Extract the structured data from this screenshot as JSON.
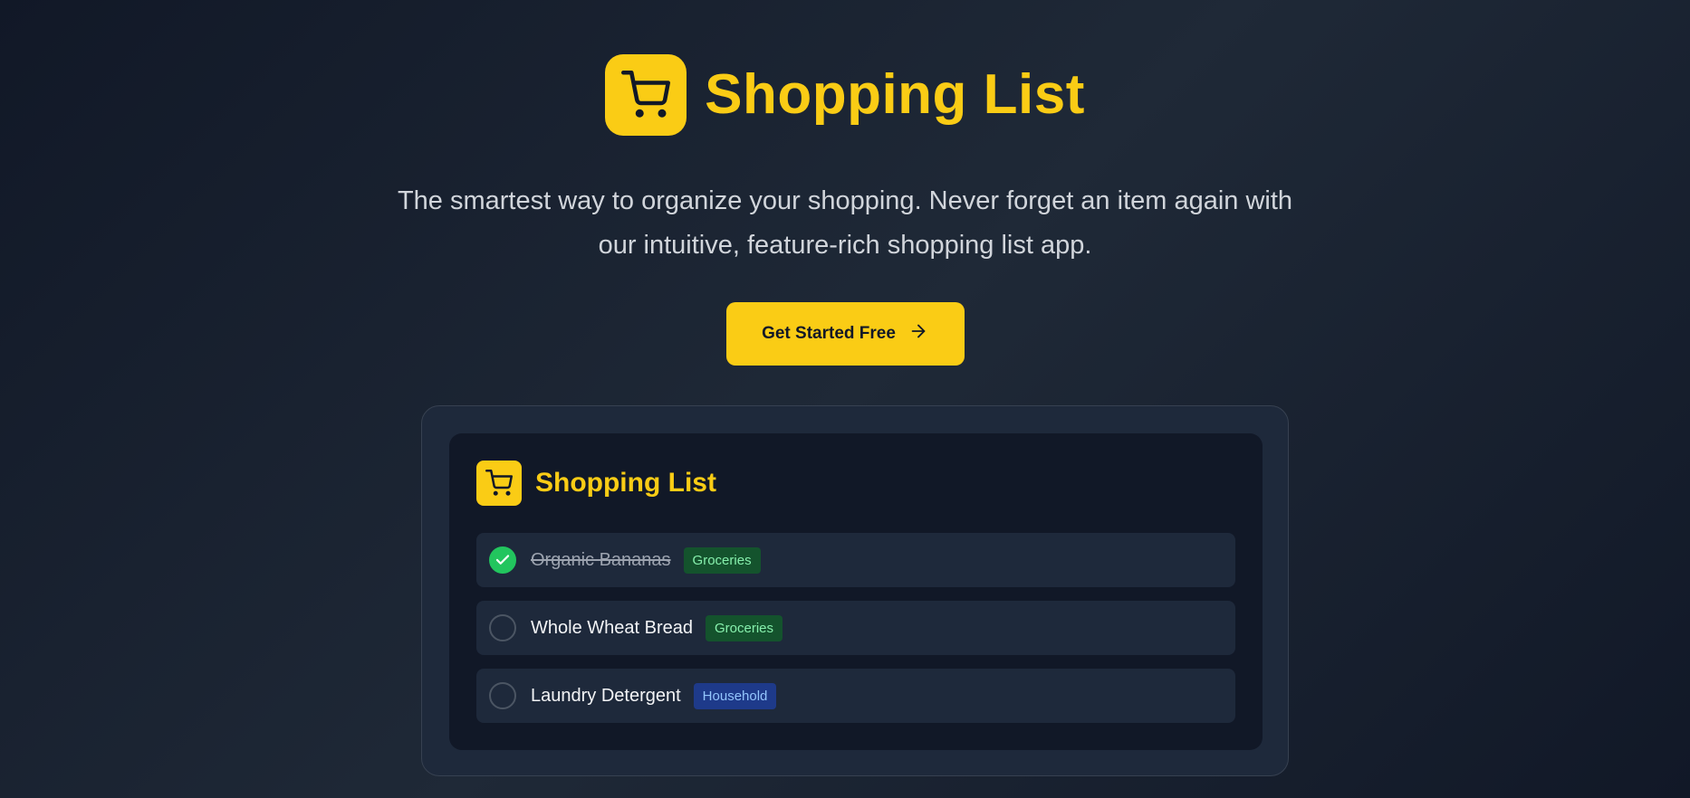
{
  "hero": {
    "title": "Shopping List",
    "tagline": "The smartest way to organize your shopping. Never forget an item again with our intuitive, feature-rich shopping list app.",
    "cta_label": "Get Started Free",
    "cta_icon": "arrow-right-icon",
    "logo_icon": "shopping-cart-icon"
  },
  "preview": {
    "title": "Shopping List",
    "logo_icon": "shopping-cart-icon",
    "items": [
      {
        "name": "Organic Bananas",
        "tag": "Groceries",
        "checked": true
      },
      {
        "name": "Whole Wheat Bread",
        "tag": "Groceries",
        "checked": false
      },
      {
        "name": "Laundry Detergent",
        "tag": "Household",
        "checked": false
      }
    ]
  },
  "colors": {
    "accent": "#facc15",
    "background": "#111827",
    "card": "#1e293b",
    "check_done": "#22c55e",
    "tag_groceries_bg": "#14532d",
    "tag_groceries_text": "#86efac",
    "tag_household_bg": "#1e3a8a",
    "tag_household_text": "#93c5fd"
  }
}
